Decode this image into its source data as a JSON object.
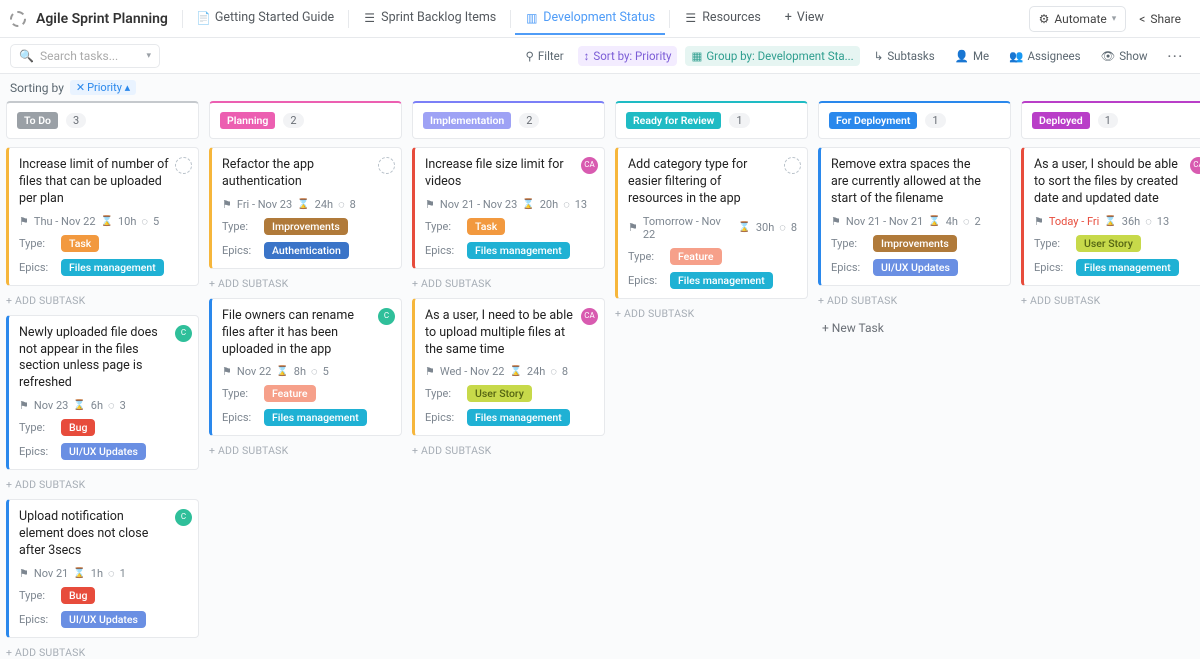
{
  "header": {
    "title": "Agile Sprint Planning",
    "tabs": [
      {
        "label": "Getting Started Guide"
      },
      {
        "label": "Sprint Backlog Items"
      },
      {
        "label": "Development Status"
      },
      {
        "label": "Resources"
      },
      {
        "label": "View"
      }
    ],
    "automate": "Automate",
    "share": "Share"
  },
  "toolbar": {
    "search_placeholder": "Search tasks...",
    "filter": "Filter",
    "sort": "Sort by: Priority",
    "group": "Group by: Development Sta...",
    "subtasks": "Subtasks",
    "me": "Me",
    "assignees": "Assignees",
    "show": "Show"
  },
  "sort_line": {
    "label": "Sorting by",
    "chip": "Priority"
  },
  "columns": [
    {
      "name": "To Do",
      "count": "3",
      "accent": "#c5c9cd",
      "chip": "#9aa0a6"
    },
    {
      "name": "Planning",
      "count": "2",
      "accent": "#ec5fb1",
      "chip": "#ec5fb1"
    },
    {
      "name": "Implementation",
      "count": "2",
      "accent": "#7b7ff7",
      "chip": "#9ea2f5"
    },
    {
      "name": "Ready for Review",
      "count": "1",
      "accent": "#1fbbc4",
      "chip": "#1fbbc4"
    },
    {
      "name": "For Deployment",
      "count": "1",
      "accent": "#2a88ec",
      "chip": "#2a88ec"
    },
    {
      "name": "Deployed",
      "count": "1",
      "accent": "#b93ec8",
      "chip": "#b93ec8"
    }
  ],
  "cards": {
    "todo": [
      {
        "title": "Increase limit of number of files that can be uploaded per plan",
        "flag": "#f6b63b",
        "flag_sym": "🟡",
        "date": "Thu  -  Nov 22",
        "hrs": "10h",
        "pts": "5",
        "type": "Task",
        "type_cls": "task",
        "epic": "Files management",
        "epic_cls": "files",
        "av": "dashed"
      },
      {
        "title": "Newly uploaded file does not appear in the files section unless page is refreshed",
        "flag": "#2a88ec",
        "flag_sym": "🔵",
        "date": "Nov 23",
        "hrs": "6h",
        "pts": "3",
        "type": "Bug",
        "type_cls": "bug",
        "epic": "UI/UX Updates",
        "epic_cls": "uiux",
        "av": "teal",
        "av_txt": "C"
      },
      {
        "title": "Upload notification element does not close after 3secs",
        "flag": "#2a88ec",
        "flag_sym": "🔵",
        "date": "Nov 21",
        "hrs": "1h",
        "pts": "1",
        "type": "Bug",
        "type_cls": "bug",
        "epic": "UI/UX Updates",
        "epic_cls": "uiux",
        "av": "teal",
        "av_txt": "C"
      }
    ],
    "planning": [
      {
        "title": "Refactor the app authentication",
        "flag": "#f6b63b",
        "flag_sym": "🟡",
        "date": "Fri  -  Nov 23",
        "hrs": "24h",
        "pts": "8",
        "type": "Improvements",
        "type_cls": "impr",
        "epic": "Authentication",
        "epic_cls": "auth",
        "av": "dashed"
      },
      {
        "title": "File owners can rename files after it has been uploaded in the app",
        "flag": "#2a88ec",
        "flag_sym": "🔵",
        "date": "Nov 22",
        "hrs": "8h",
        "pts": "5",
        "type": "Feature",
        "type_cls": "feature",
        "epic": "Files management",
        "epic_cls": "files",
        "av": "teal",
        "av_txt": "C"
      }
    ],
    "impl": [
      {
        "title": "Increase file size limit for videos",
        "flag": "#e74c3c",
        "flag_sym": "🔴",
        "date": "Nov 21  -  Nov 23",
        "hrs": "20h",
        "pts": "13",
        "type": "Task",
        "type_cls": "task",
        "epic": "Files management",
        "epic_cls": "files",
        "av": "pink",
        "av_txt": "CA"
      },
      {
        "title": "As a user, I need to be able to upload multiple files at the same time",
        "flag": "#f6b63b",
        "flag_sym": "🟡",
        "date": "Wed  -  Nov 22",
        "hrs": "24h",
        "pts": "8",
        "type": "User Story",
        "type_cls": "story",
        "epic": "Files management",
        "epic_cls": "files",
        "av": "pink",
        "av_txt": "CA"
      }
    ],
    "review": [
      {
        "title": "Add category type for easier filtering of resources in the app",
        "flag": "#f6b63b",
        "flag_sym": "🟡",
        "date": "Tomorrow  -  Nov 22",
        "hrs": "30h",
        "pts": "8",
        "type": "Feature",
        "type_cls": "feature",
        "epic": "Files management",
        "epic_cls": "files",
        "av": "dashed"
      }
    ],
    "deploy": [
      {
        "title": "Remove extra spaces the are currently allowed at the start of the filename",
        "flag": "#2a88ec",
        "flag_sym": "🔵",
        "date": "Nov 21  -  Nov 21",
        "hrs": "4h",
        "pts": "2",
        "type": "Improvements",
        "type_cls": "impr",
        "epic": "UI/UX Updates",
        "epic_cls": "uiux",
        "av": ""
      }
    ],
    "deployed": [
      {
        "title": "As a user, I should be able to sort the files by created date and updated date",
        "flag": "#e74c3c",
        "flag_sym": "🔴",
        "date": "Today  -  Fri",
        "date_red": true,
        "hrs": "36h",
        "pts": "13",
        "type": "User Story",
        "type_cls": "story",
        "epic": "Files management",
        "epic_cls": "files",
        "av": "pink",
        "av_txt": "CA"
      }
    ]
  },
  "labels": {
    "type": "Type:",
    "epics": "Epics:",
    "add_subtask": "+ ADD SUBTASK",
    "new_task": "+ New Task"
  }
}
